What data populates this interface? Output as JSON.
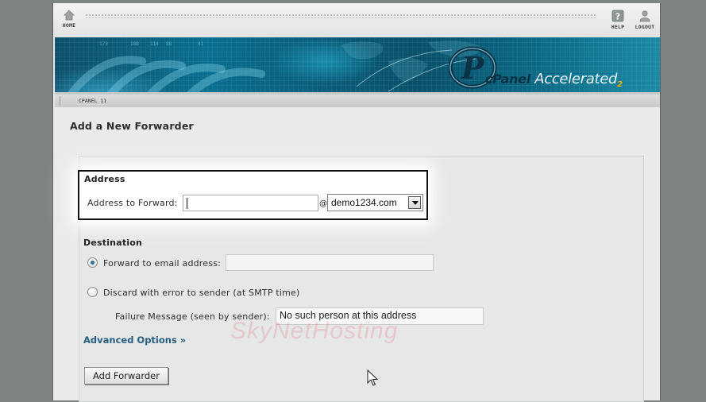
{
  "topnav": {
    "home_label": "HOME",
    "help_label": "HELP",
    "logout_label": "LOGOUT"
  },
  "banner": {
    "logo_brand": "cPanel",
    "logo_product": "Accelerated",
    "logo_version": "2"
  },
  "subbar": {
    "version_label": "CPANEL 11"
  },
  "page": {
    "title": "Add a New Forwarder"
  },
  "address": {
    "heading": "Address",
    "label": "Address to Forward:",
    "value": "",
    "at_sign": "@",
    "domain_selected": "demo1234.com"
  },
  "destination": {
    "heading": "Destination",
    "forward_label": "Forward to email address:",
    "forward_value": "",
    "forward_checked": true,
    "discard_label": "Discard with error to sender (at SMTP time)",
    "discard_checked": false,
    "failure_label": "Failure Message (seen by sender):",
    "failure_value": "No such person at this address"
  },
  "advanced_options": {
    "label": "Advanced Options »"
  },
  "actions": {
    "add_forwarder_label": "Add Forwarder"
  },
  "watermark": {
    "sky": "SkyNet",
    "hosting": "Hosting"
  },
  "colors": {
    "page_bg": "#e9eaea",
    "link": "#245f80",
    "banner": "#0a6f8f",
    "radio_dot": "#2f6f98"
  }
}
